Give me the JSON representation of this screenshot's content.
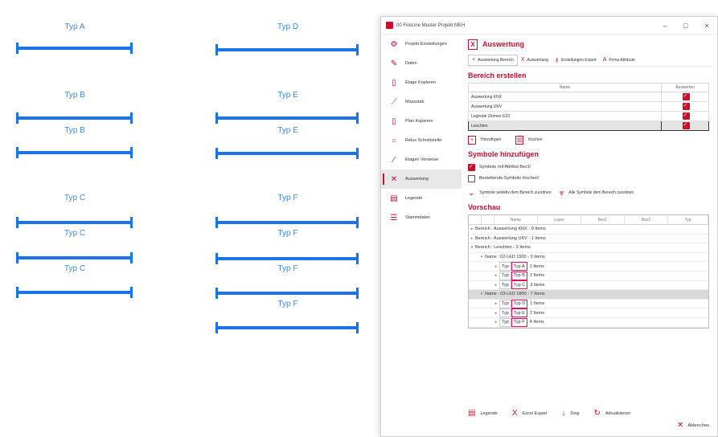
{
  "canvas": {
    "labels": [
      "Typ A",
      "Typ B",
      "Typ B",
      "Typ C",
      "Typ C",
      "Typ C",
      "Typ D",
      "Typ E",
      "Typ E",
      "Typ F",
      "Typ F",
      "Typ F",
      "Typ F"
    ]
  },
  "window": {
    "title": "00 FireLine Muster Projekt MEH",
    "controls": [
      "–",
      "□",
      "×"
    ]
  },
  "sidebar": {
    "items": [
      {
        "label": "Projekt Einstellungen",
        "icon": "gear-icon"
      },
      {
        "label": "Daten",
        "icon": "pencil-icon"
      },
      {
        "label": "Etage Kopieren",
        "icon": "page-icon"
      },
      {
        "label": "Massstab",
        "icon": "ruler-icon"
      },
      {
        "label": "Plan Kopieren",
        "icon": "page-icon"
      },
      {
        "label": "Relux Schnittstelle",
        "icon": "bulb-icon"
      },
      {
        "label": "Etagen Verweise",
        "icon": "pin-icon"
      },
      {
        "label": "Auswertung",
        "icon": "excel-icon"
      },
      {
        "label": "Legende",
        "icon": "table-icon"
      },
      {
        "label": "Stammdaten",
        "icon": "list-icon"
      }
    ]
  },
  "main": {
    "title": "Auswertung",
    "tabs": [
      "Auswertung Bereich",
      "Auswertung",
      "Erstellungen Expert",
      "Firma Attribute"
    ],
    "bereich_title": "Bereich erstellen",
    "grid_headers": [
      "Name",
      "Auswerten"
    ],
    "grid_rows": [
      "Auswertung KNX",
      "Auswertung UKV",
      "Legende Zimmer E03",
      "Leuchten"
    ],
    "add_label": "Hinzufügen",
    "delete_label": "löschen",
    "symbole_title": "Symbole hinzufügen",
    "opt1": "Symbole mit Attribut Bez1!",
    "opt2": "Bestehende Symbole löschen!",
    "assign1": "Symbole selektiv dem Bereich zuordnen",
    "assign2": "Alle Symbole dem Bereich zuordnen",
    "vorschau_title": "Vorschau",
    "tree_headers": [
      "Name",
      "Layer",
      "Bez1",
      "Bez2",
      "Typ"
    ],
    "tree": {
      "r1": "Bereich : Auswertung KNX - 9 Items",
      "r2": "Bereich : Auswertung UKV - 1 Items",
      "r3": "Bereich : Leuchten - 2 Items",
      "r4": "Name : 02-LED 1500 - 3 Items",
      "r5a": "Typ",
      "r5b": "Typ A",
      "r5c": "1 Items",
      "r6a": "Typ",
      "r6b": "Typ B",
      "r6c": "2 Items",
      "r7a": "Typ",
      "r7b": "Typ C",
      "r7c": "3 Items",
      "r8": "Name : 03-LED 1800 - 7 Items",
      "r9a": "Typ",
      "r9b": "Typ D",
      "r9c": "1 Items",
      "r10a": "Typ",
      "r10b": "Typ E",
      "r10c": "2 Items",
      "r11a": "Typ",
      "r11b": "Typ F",
      "r11c": "4 Items"
    },
    "footer": [
      "Legende",
      "Excel Export",
      "Dwg",
      "Aktualisieren"
    ],
    "close_label": "Abbrechen"
  },
  "colors": {
    "accent": "#c8102e",
    "cad_blue": "#1a73e8"
  }
}
